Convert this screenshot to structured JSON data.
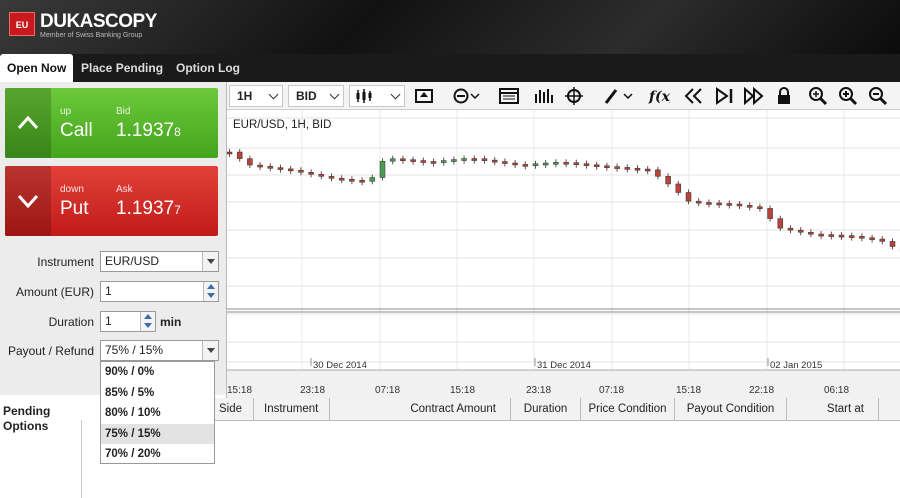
{
  "brand": {
    "logo_badge": "EU",
    "name": "DUKASCOPY",
    "tagline": "Member of Swiss Banking Group"
  },
  "tabs": [
    {
      "label": "Open Now",
      "active": true
    },
    {
      "label": "Place Pending",
      "active": false
    },
    {
      "label": "Option Log",
      "active": false
    }
  ],
  "call": {
    "direction": "up",
    "label": "Call",
    "price_label": "Bid",
    "price_main": "1.1937",
    "price_sub": "8"
  },
  "put": {
    "direction": "down",
    "label": "Put",
    "price_label": "Ask",
    "price_main": "1.1937",
    "price_sub": "7"
  },
  "form": {
    "instrument_label": "Instrument",
    "instrument_value": "EUR/USD",
    "amount_label": "Amount (EUR)",
    "amount_value": "1",
    "duration_label": "Duration",
    "duration_value": "1",
    "duration_unit": "min",
    "payout_label": "Payout / Refund",
    "payout_value": "75% / 15%",
    "payout_options": [
      "90% / 0%",
      "85% / 5%",
      "80% / 10%",
      "75% / 15%",
      "70% / 20%"
    ],
    "payout_selected_index": 3
  },
  "toolbar": {
    "period": "1H",
    "price_type": "BID"
  },
  "chart_data": {
    "type": "candlestick",
    "title": "EUR/USD, 1H, BID",
    "x_tick_labels": [
      "15:18",
      "23:18",
      "07:18",
      "15:18",
      "23:18",
      "07:18",
      "15:18",
      "22:18",
      "06:18"
    ],
    "date_labels": [
      "30 Dec 2014",
      "31 Dec 2014",
      "02 Jan 2015"
    ],
    "grid": true
  },
  "pending": {
    "title_line1": "Pending",
    "title_line2": "Options",
    "columns": [
      "Side",
      "Instrument",
      "Contract Amount",
      "Duration",
      "Price Condition",
      "Payout Condition",
      "Start at"
    ]
  },
  "colors": {
    "call": "#4aa823",
    "put": "#cc2420",
    "bull_candle": "#4e9a54",
    "bear_candle": "#b7433a"
  }
}
